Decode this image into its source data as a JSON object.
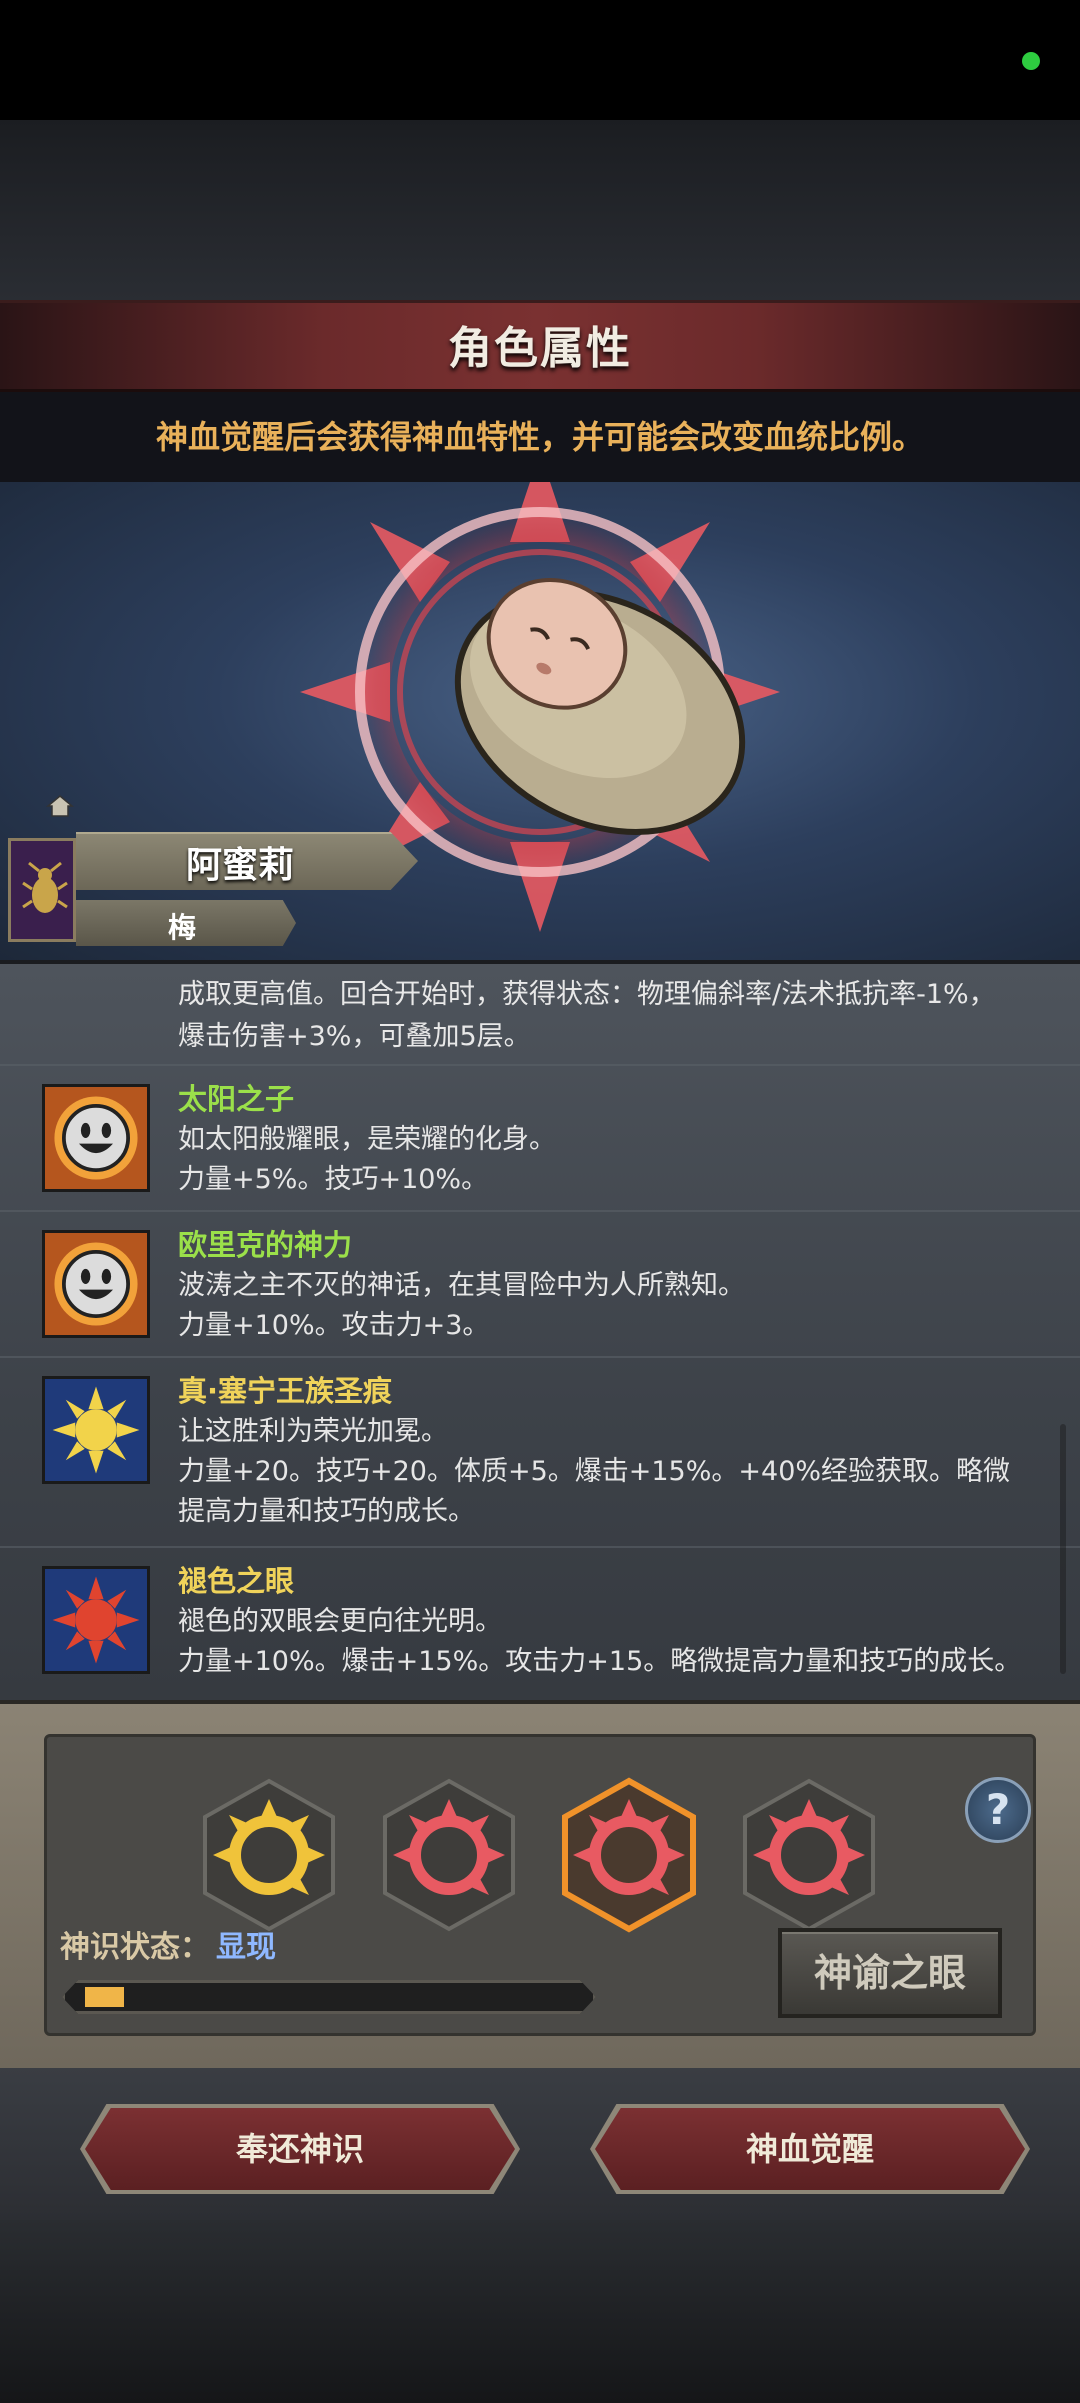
{
  "header": {
    "title": "角色属性",
    "hint": "神血觉醒后会获得神血特性，并可能会改变血统比例。"
  },
  "character": {
    "name": "阿蜜莉",
    "subtitle": "梅"
  },
  "traits": {
    "continuation": [
      "成取更高值。回合开始时，获得状态：物理偏斜率/法术抵抗率-1%，",
      "爆击伤害+3%，可叠加5层。"
    ],
    "items": [
      {
        "title": "太阳之子",
        "color": "#9be04a",
        "desc": [
          "如太阳般耀眼，是荣耀的化身。",
          "力量+5%。技巧+10%。"
        ],
        "icon": "smiley-sun-icon"
      },
      {
        "title": "欧里克的神力",
        "color": "#9be04a",
        "desc": [
          "波涛之主不灭的神话，在其冒险中为人所熟知。",
          "力量+10%。攻击力+3。"
        ],
        "icon": "smiley-sun-icon"
      },
      {
        "title": "真·塞宁王族圣痕",
        "color": "#f0d35a",
        "desc": [
          "让这胜利为荣光加冕。",
          "力量+20。技巧+20。体质+5。爆击+15%。+40%经验获取。略微",
          "提高力量和技巧的成长。"
        ],
        "icon": "golden-sun-icon"
      },
      {
        "title": "褪色之眼",
        "color": "#f0d35a",
        "desc": [
          "褪色的双眼会更向往光明。",
          "力量+10%。爆击+15%。攻击力+15。略微提高力量和技巧的成长。"
        ],
        "icon": "red-sun-icon"
      }
    ]
  },
  "divine": {
    "state_label": "神识状态：",
    "state_value": "显现",
    "progress": 0.08,
    "oracle_button": "神谕之眼",
    "help": "?"
  },
  "actions": {
    "return_label": "奉还神识",
    "awaken_label": "神血觉醒"
  },
  "colors": {
    "accent_gold": "#e9b15a",
    "green_title": "#9be04a",
    "yellow_title": "#f0d35a"
  }
}
